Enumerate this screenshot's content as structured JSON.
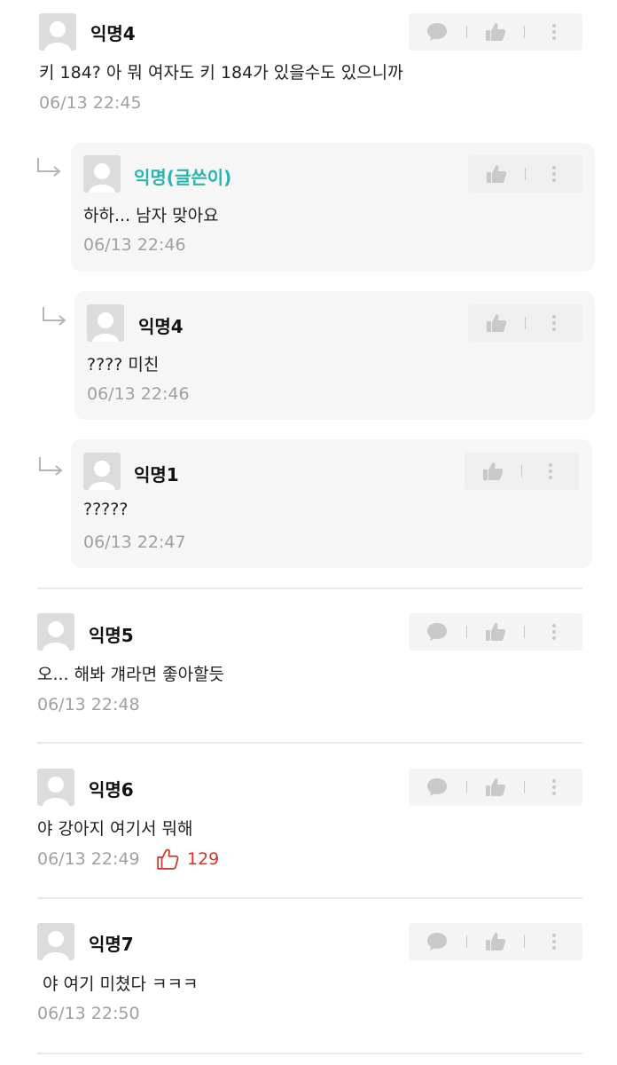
{
  "comments": [
    {
      "author": "익명4",
      "text": "키 184? 아 뭐 여자도 키 184가 있을수도 있으니까",
      "time": "06/13 22:45"
    },
    {
      "author": "익명5",
      "text": "오... 해봐 걔라면 좋아할듯",
      "time": "06/13 22:48"
    },
    {
      "author": "익명6",
      "text": "야 강아지 여기서 뭐해",
      "time": "06/13 22:49",
      "likes": "129"
    },
    {
      "author": "익명7",
      "text": " 야 여기 미쳤다 ㅋㅋㅋ",
      "time": "06/13 22:50"
    }
  ],
  "replies": [
    {
      "author": "익명(글쓴이)",
      "text": "하하... 남자 맞아요",
      "time": "06/13 22:46"
    },
    {
      "author": "익명4",
      "text": "???? 미친",
      "time": "06/13 22:46"
    },
    {
      "author": "익명1",
      "text": "?????",
      "time": "06/13 22:47"
    }
  ],
  "colors": {
    "op_author": "#2bb3b0",
    "like_count": "#d0342c",
    "icon_gray": "#c9c9c9"
  },
  "icons": {
    "comment": "speech-bubble-icon",
    "like": "thumbs-up-icon",
    "more": "more-vertical-icon",
    "reply": "reply-arrow-icon"
  }
}
